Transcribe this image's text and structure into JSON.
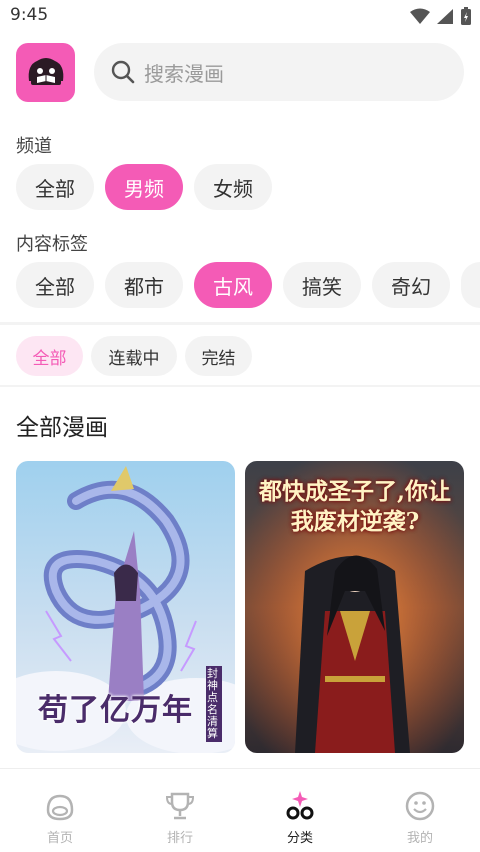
{
  "status_bar": {
    "time": "9:45"
  },
  "search": {
    "placeholder": "搜索漫画"
  },
  "channel": {
    "label": "频道",
    "options": [
      "全部",
      "男频",
      "女频"
    ],
    "selected": "男频"
  },
  "tags": {
    "label": "内容标签",
    "options": [
      "全部",
      "都市",
      "古风",
      "搞笑",
      "奇幻"
    ],
    "selected": "古风"
  },
  "status_filter": {
    "options": [
      "全部",
      "连载中",
      "完结"
    ],
    "selected": "全部"
  },
  "section": {
    "title": "全部漫画"
  },
  "comics": [
    {
      "cover_title": "苟了亿万年",
      "cover_subtitle": "封神点名清算"
    },
    {
      "cover_title": "都快成圣子了,你让我废材逆袭?"
    }
  ],
  "nav": {
    "items": [
      {
        "label": "首页",
        "icon": "home-face-icon"
      },
      {
        "label": "排行",
        "icon": "trophy-icon"
      },
      {
        "label": "分类",
        "icon": "category-icon"
      },
      {
        "label": "我的",
        "icon": "smiley-icon"
      }
    ],
    "active": "分类"
  },
  "colors": {
    "accent": "#f45bb6",
    "accent_light": "#fde6f3",
    "chip_bg": "#f3f3f3"
  }
}
